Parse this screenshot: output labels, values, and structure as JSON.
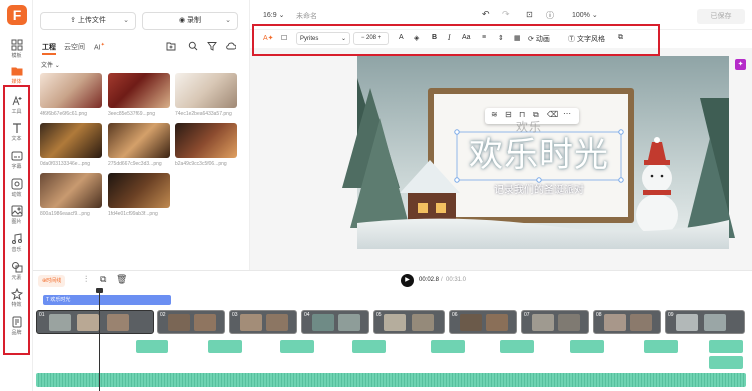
{
  "rail": {
    "items": [
      {
        "label": "模板",
        "icon": "template-icon"
      },
      {
        "label": "媒体",
        "icon": "media-icon"
      },
      {
        "label": "工具",
        "icon": "ai-tools-icon"
      },
      {
        "label": "文本",
        "icon": "text-icon"
      },
      {
        "label": "字幕",
        "icon": "subtitle-icon"
      },
      {
        "label": "动效",
        "icon": "effects-icon"
      },
      {
        "label": "图片",
        "icon": "image-icon"
      },
      {
        "label": "音乐",
        "icon": "music-icon"
      },
      {
        "label": "元素",
        "icon": "elements-icon"
      },
      {
        "label": "特效",
        "icon": "special-effects-icon"
      },
      {
        "label": "品牌",
        "icon": "brand-icon"
      }
    ]
  },
  "library": {
    "upload_label": "上传文件",
    "record_label": "录制",
    "tabs": [
      {
        "label": "工程"
      },
      {
        "label": "云空间"
      },
      {
        "label": "AI"
      }
    ],
    "ai_badge": "✦",
    "folder_label": "文件",
    "files": [
      {
        "name": "4f6f6b67e6f6c61.png"
      },
      {
        "name": "3eec85e537f69...png"
      },
      {
        "name": "74ec1e2bea6433a57.png"
      },
      {
        "name": "0da0f03133346e...png"
      },
      {
        "name": "275dd667c9ec3d3...png"
      },
      {
        "name": "b2a49c9cc3c5f06...png"
      },
      {
        "name": "800a1986eaacf9...png"
      },
      {
        "name": "1fd4e01cf99ab3f...png"
      }
    ]
  },
  "topbar": {
    "ratio": "16:9",
    "title": "未命名",
    "zoom": "100%",
    "export_label": "已保存"
  },
  "format": {
    "font": "Pyrites",
    "size": "208",
    "anim_label": "动画",
    "style_label": "文字风格"
  },
  "canvas": {
    "title_text": "欢乐时光",
    "subtitle_text": "记录我们的圣诞派对",
    "ghost_text": "欢乐"
  },
  "timeline": {
    "current": "00:02.8",
    "total": "00:31.0",
    "track_tag": "时间线",
    "text_clip": "欢乐时光",
    "clip_nums": [
      "01",
      "02",
      "03",
      "04",
      "05",
      "06",
      "07",
      "08",
      "09"
    ]
  },
  "colors": {
    "accent": "#f26b2a",
    "highlight": "#d81e2c",
    "audio": "#6fd3b2",
    "text_clip": "#6b8ff2"
  }
}
